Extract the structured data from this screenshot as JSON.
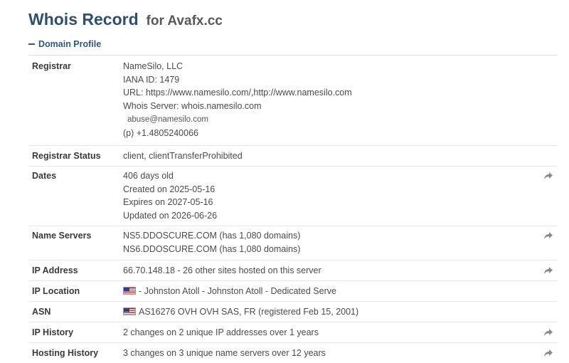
{
  "header": {
    "title": "Whois Record",
    "domain_label": "for Avafx.cc"
  },
  "section": {
    "label": "Domain Profile"
  },
  "registrar": {
    "label": "Registrar",
    "name": "NameSilo, LLC",
    "iana": "IANA ID: 1479",
    "url": "URL: https://www.namesilo.com/,http://www.namesilo.com",
    "whois_server": "Whois Server: whois.namesilo.com",
    "abuse_email": "abuse@namesilo.com",
    "phone": "(p) +1.4805240066"
  },
  "registrar_status": {
    "label": "Registrar Status",
    "value": "client, clientTransferProhibited"
  },
  "dates": {
    "label": "Dates",
    "age": "406 days old",
    "created": "Created on 2025-05-16",
    "expires": "Expires on 2027-05-16",
    "updated": "Updated on 2026-06-26"
  },
  "name_servers": {
    "label": "Name Servers",
    "ns1": "NS5.DDOSCURE.COM (has 1,080 domains)",
    "ns2": "NS6.DDOSCURE.COM (has 1,080 domains)"
  },
  "ip_address": {
    "label": "IP Address",
    "value": "66.70.148.18 - 26 other sites hosted on this server"
  },
  "ip_location": {
    "label": "IP Location",
    "value": "- Johnston Atoll - Johnston Atoll - Dedicated Serve"
  },
  "asn": {
    "label": "ASN",
    "value": "AS16276 OVH OVH SAS, FR (registered Feb 15, 2001)"
  },
  "ip_history": {
    "label": "IP History",
    "value": "2 changes on 2 unique IP addresses over 1 years"
  },
  "hosting_history": {
    "label": "Hosting History",
    "value": "3 changes on 3 unique name servers over 12 years"
  },
  "icons": {
    "share": "share-arrow-icon",
    "flag": "us-flag-icon",
    "collapse": "minus-icon"
  },
  "colors": {
    "title": "#2f4f6e",
    "section": "#2c5a83",
    "icon": "#8a8a8a"
  }
}
